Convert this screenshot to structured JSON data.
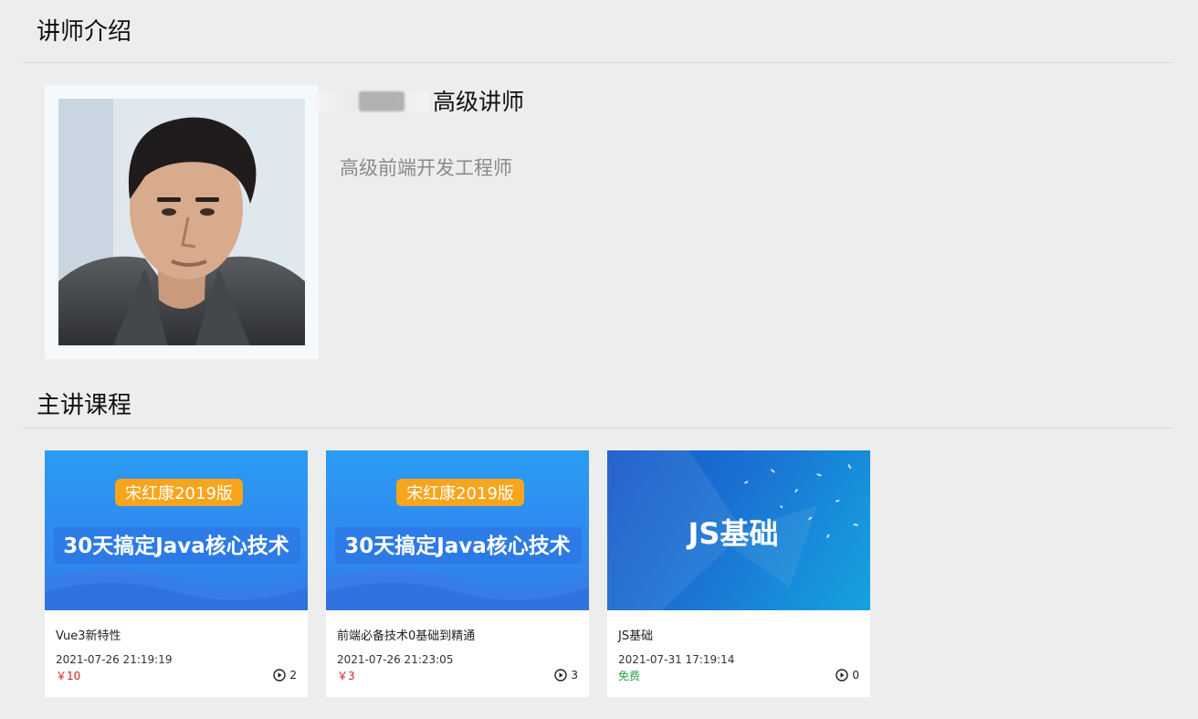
{
  "sections": {
    "teacher_title": "讲师介绍",
    "courses_title": "主讲课程"
  },
  "teacher": {
    "level": "高级讲师",
    "intro": "高级前端开发工程师",
    "name_blurred": true
  },
  "courses": [
    {
      "cover_badge": "宋红康2019版",
      "cover_headline": "30天搞定Java核心技术",
      "title": "Vue3新特性",
      "time": "2021-07-26 21:19:19",
      "price": "￥10",
      "views": "2"
    },
    {
      "cover_badge": "宋红康2019版",
      "cover_headline": "30天搞定Java核心技术",
      "title": "前端必备技术0基础到精通",
      "time": "2021-07-26 21:23:05",
      "price": "￥3",
      "views": "3"
    },
    {
      "cover_headline": "JS基础",
      "title": "JS基础",
      "time": "2021-07-31 17:19:14",
      "price": "免费",
      "views": "0"
    }
  ],
  "colors": {
    "page_bg": "#ededed",
    "price_paid": "#e02020",
    "price_free": "#2aa14a",
    "badge": "#f7a51d",
    "cover_blue": "#2f8af0"
  },
  "icons": {
    "views": "play-circle-icon"
  }
}
